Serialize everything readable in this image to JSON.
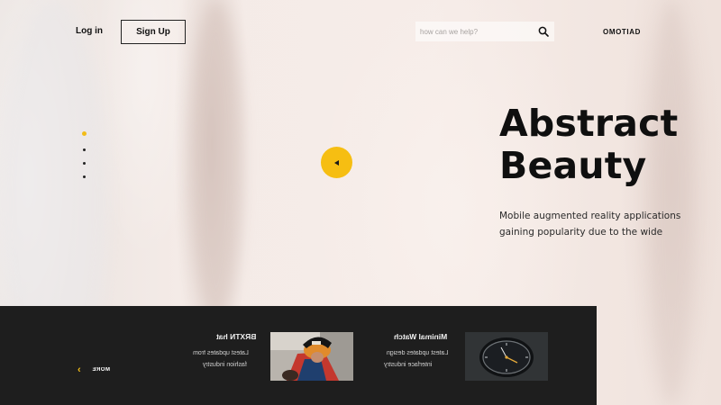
{
  "header": {
    "login_label": "Log in",
    "signup_label": "Sign Up",
    "search_placeholder": "how can we help?",
    "search_icon": "search-icon",
    "logo_text": "OMOTIAD"
  },
  "pager": {
    "count": 4,
    "active_index": 0
  },
  "hero": {
    "title_line1": "Abstract",
    "title_line2": "Beauty",
    "subtitle_line1": "Mobile augmented reality applications",
    "subtitle_line2": "gaining popularity due to the wide"
  },
  "colors": {
    "accent": "#f6be12",
    "panel": "#1e1e1e",
    "text": "#0f0f0f"
  },
  "panel": {
    "more_label": "MORE",
    "more_icon": "chevron-left-icon",
    "cards": [
      {
        "name": "BRXTN hat",
        "desc_line1": "Latest updates from",
        "desc_line2": "fashion industry"
      },
      {
        "name": "Minimal Watch",
        "desc_line1": "Latest updates design",
        "desc_line2": "interface industry"
      }
    ]
  }
}
